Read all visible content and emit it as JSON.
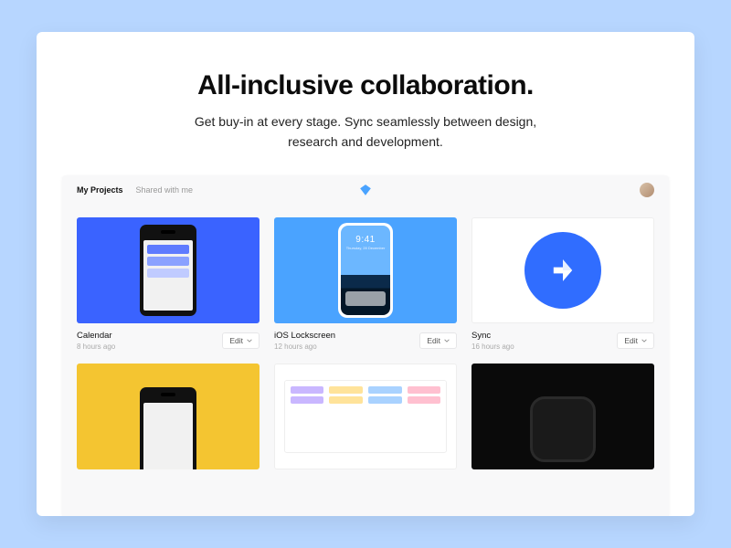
{
  "hero": {
    "headline": "All-inclusive collaboration.",
    "subhead": "Get buy-in at every stage. Sync seamlessly between design, research and development."
  },
  "app": {
    "tabs": {
      "my_projects": "My Projects",
      "shared": "Shared with me"
    },
    "edit_label": "Edit",
    "lockscreen_time": "9:41",
    "lockscreen_date": "Thursday, 28 December",
    "projects": [
      {
        "name": "Calendar",
        "time": "8 hours ago"
      },
      {
        "name": "iOS Lockscreen",
        "time": "12 hours ago"
      },
      {
        "name": "Sync",
        "time": "16 hours ago"
      }
    ]
  }
}
